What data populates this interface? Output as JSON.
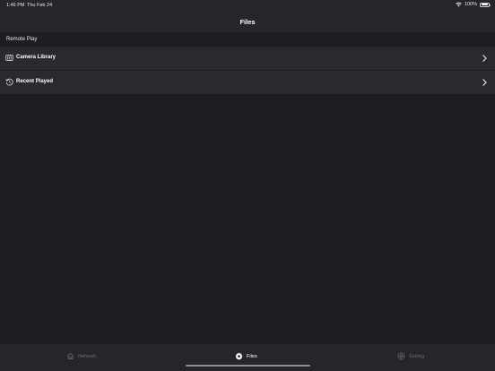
{
  "status_bar": {
    "time": "1:46 PM",
    "date": "Thu Feb 24",
    "battery": "100%"
  },
  "nav": {
    "title": "Files"
  },
  "section": {
    "header": "Remote Play",
    "items": [
      {
        "label": "Camera Library",
        "icon": "camera-library-icon"
      },
      {
        "label": "Recent Played",
        "icon": "history-icon"
      }
    ]
  },
  "tabs": [
    {
      "label": "Network",
      "icon": "home-icon",
      "active": false
    },
    {
      "label": "Files",
      "icon": "gear-icon",
      "active": true
    },
    {
      "label": "Setting",
      "icon": "aperture-icon",
      "active": false
    }
  ],
  "colors": {
    "background": "#1e1d23",
    "bar": "#26252c",
    "row": "#2a2930",
    "inactive_tab": "#6e6d74",
    "text": "#ffffff"
  }
}
